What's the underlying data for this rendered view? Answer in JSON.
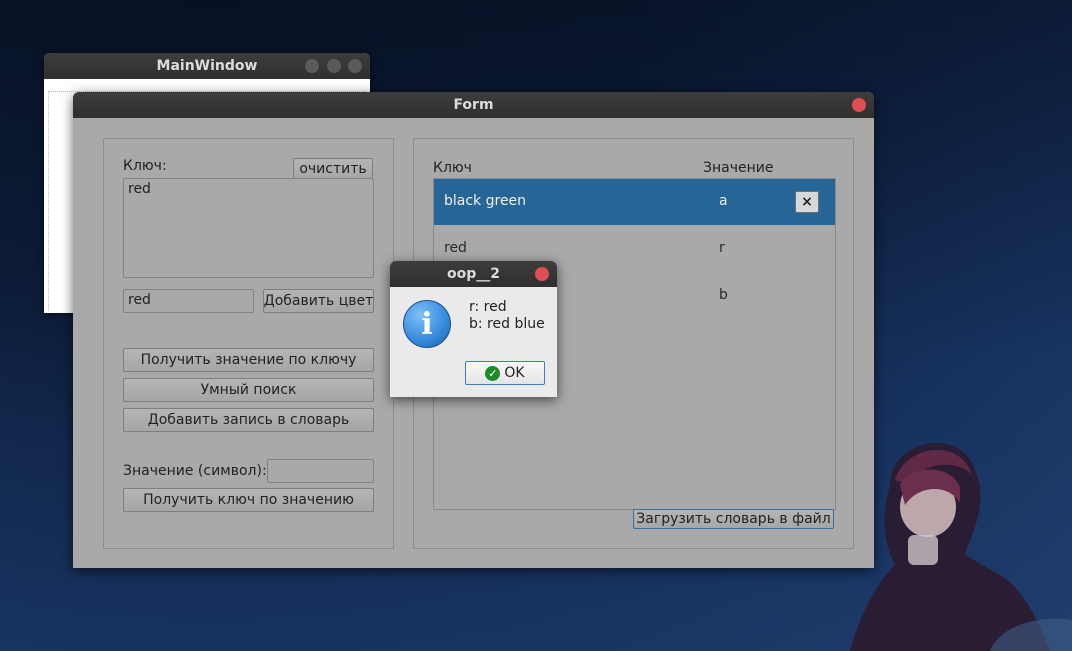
{
  "main_window": {
    "title": "MainWindow"
  },
  "form": {
    "title": "Form",
    "left_panel": {
      "key_label": "Ключ:",
      "clear_button": "очистить",
      "key_text": "red",
      "color_input_value": "red",
      "add_color_button": "Добавить цвет",
      "get_value_button": "Получить значение по ключу",
      "smart_search_button": "Умный поиск",
      "add_entry_button": "Добавить запись в словарь",
      "value_label": "Значение (символ):",
      "value_input_value": "",
      "get_key_button": "Получить ключ по значению"
    },
    "right_panel": {
      "col_key": "Ключ",
      "col_value": "Значение",
      "rows": [
        {
          "key": "black green",
          "value": "a",
          "selected": true
        },
        {
          "key": "red",
          "value": "r"
        },
        {
          "key": "",
          "value": "b"
        }
      ],
      "delete_icon": "×",
      "save_button": "Загрузить словарь в файл"
    }
  },
  "message_box": {
    "title": "oop__2",
    "icon": "info-icon",
    "lines": [
      "r: red",
      "b: red blue"
    ],
    "ok_label": "OK"
  },
  "colors": {
    "selection": "#276596",
    "close": "#e04f4f"
  }
}
